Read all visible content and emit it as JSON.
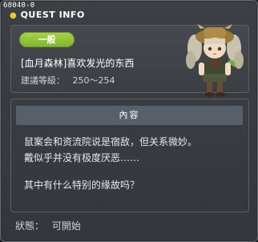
{
  "window": {
    "quest_id": "68040-0",
    "title": "QUEST INFO"
  },
  "quest": {
    "category_badge": "一般",
    "name": "[血月森林]喜欢发光的东西",
    "level_label": "建議等級：",
    "level_range": "250～254"
  },
  "content": {
    "header": "內容",
    "lines": [
      "鼠案会和资流院说是宿敌，但关系微妙。",
      "戴似乎并没有极度厌恶……",
      "其中有什么特别的缘故吗？"
    ]
  },
  "status": {
    "label": "狀態：",
    "value": "可開始"
  },
  "colors": {
    "badge_green": "#8cc43a",
    "title_dot": "#f2c531",
    "panel_bg": "#3b3f44",
    "content_header_bg": "#57606a"
  },
  "icons": {
    "portrait": "npc-portrait-girl-with-hat"
  }
}
